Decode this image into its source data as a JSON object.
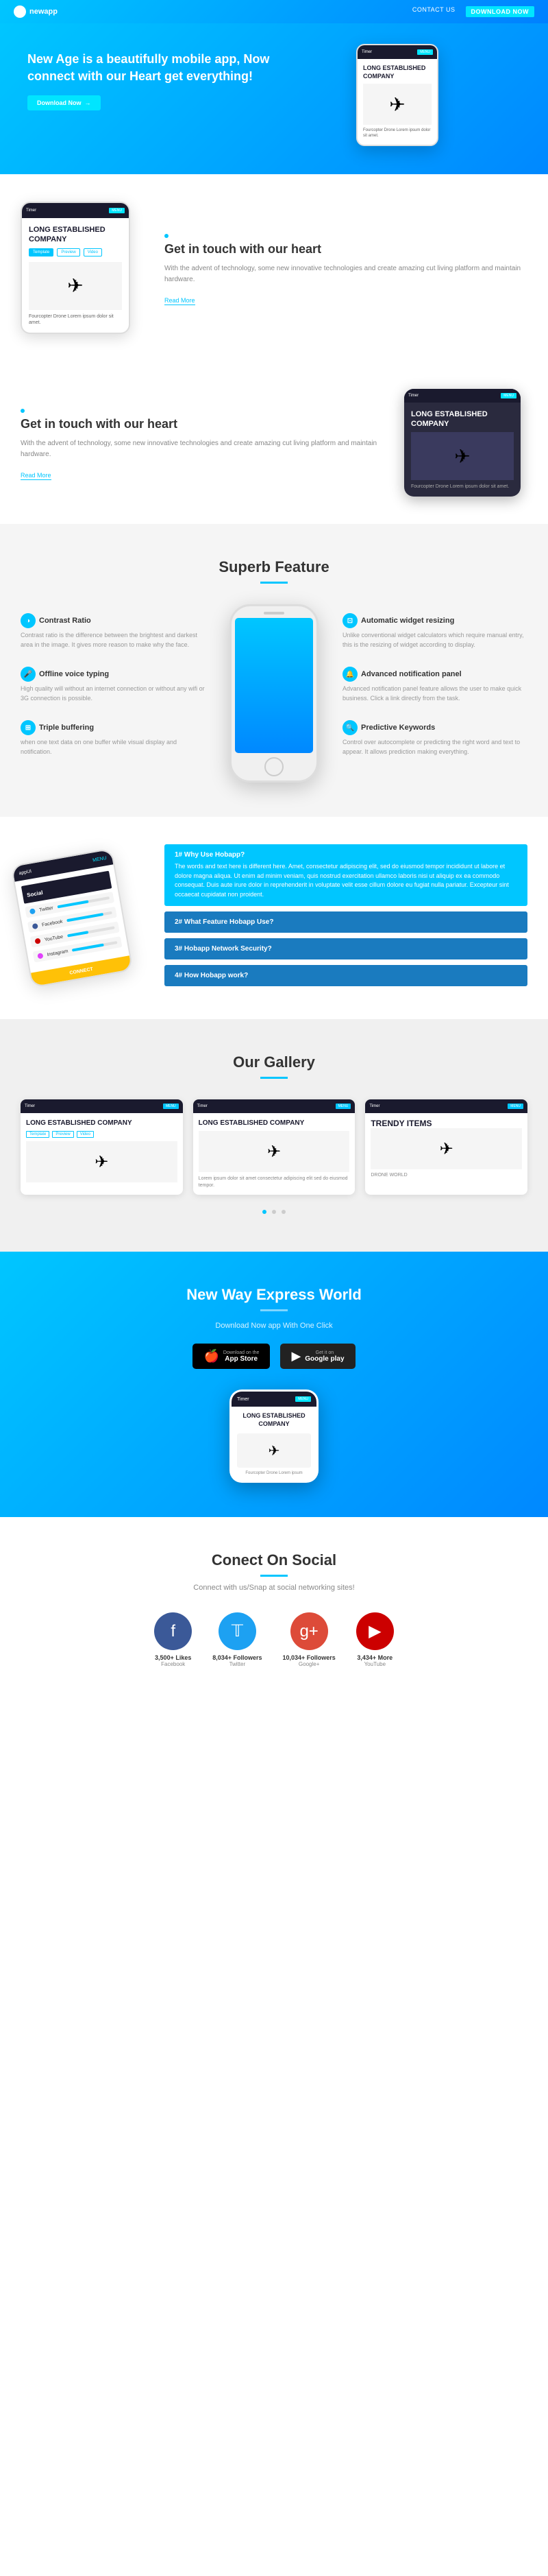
{
  "header": {
    "logo_text": "newapp",
    "nav_contact": "CONTACT US",
    "nav_download": "DOWNLOAD NOW"
  },
  "hero": {
    "title": "New Age is a beautifully mobile app, Now connect with our Heart get everything!",
    "btn_label": "Download Now",
    "phone": {
      "logo": "Timer",
      "btn": "MENU",
      "title": "LONG ESTABLISHED COMPANY",
      "caption": "Fourcopter Drone Lorem ipsum dolor sit amet."
    }
  },
  "section2": {
    "dot_label": "",
    "title": "Get in touch with our heart",
    "text": "With the advent of technology, some new innovative technologies and create amazing cut living platform and maintain hardware.",
    "link": "Read More",
    "phone": {
      "logo": "Timer",
      "btn": "MENU",
      "title": "LONG ESTABLISHED COMPANY",
      "tab1": "Template",
      "tab2": "Preview",
      "tab3": "Video",
      "caption": "Fourcopter Drone Lorem ipsum dolor sit amet."
    }
  },
  "section3": {
    "title": "Get in touch with our heart",
    "text": "With the advent of technology, some new innovative technologies and create amazing cut living platform and maintain hardware.",
    "link": "Read More",
    "phone": {
      "logo": "Timer",
      "btn": "MENU",
      "title": "LONG ESTABLISHED COMPANY",
      "caption": "Fourcopter Drone Lorem ipsum dolor sit amet."
    }
  },
  "superb": {
    "title": "Superb Feature",
    "features_left": [
      {
        "title": "Contrast Ratio",
        "text": "Contrast ratio is the difference between the brightest and darkest area in the image. It gives more reason to make why the face."
      },
      {
        "title": "Offline voice typing",
        "text": "High quality will without an internet connection or without any wifi or 3G connection is possible."
      },
      {
        "title": "Triple buffering",
        "text": "when one text data on one buffer while visual display and notification."
      }
    ],
    "features_right": [
      {
        "title": "Automatic widget resizing",
        "text": "Unlike conventional widget calculators which require manual entry, this is the resizing of widget according to display."
      },
      {
        "title": "Advanced notification panel",
        "text": "Advanced notification panel feature allows the user to make quick business. Click a link directly from the task."
      },
      {
        "title": "Predictive Keywords",
        "text": "Control over autocomplete or predicting the right word and text to appear. It allows prediction making everything."
      }
    ]
  },
  "why": {
    "cards": [
      {
        "title": "1# Why Use Hobapp?",
        "body": "The words and text here is different here. Amet, consectetur adipiscing elit, sed do eiusmod tempor incididunt ut labore et dolore magna aliqua. Ut enim ad minim veniam, quis nostrud exercitation ullamco laboris nisi ut aliquip ex ea commodo consequat. Duis aute irure dolor in reprehenderit in voluptate velit esse cillum dolore eu fugiat nulla pariatur. Excepteur sint occaecat cupidatat non proident."
      },
      {
        "title": "2# What Feature Hobapp Use?",
        "body": ""
      },
      {
        "title": "3# Hobapp Network Security?",
        "body": ""
      },
      {
        "title": "4# How Hobapp work?",
        "body": ""
      }
    ],
    "social_labels": [
      "Social",
      "Twitter",
      "Facebook",
      "YouTube",
      "Instagram"
    ],
    "social_values": [
      80,
      60,
      90,
      45,
      70
    ]
  },
  "gallery": {
    "title": "Our Gallery",
    "items": [
      {
        "logo": "Timer",
        "btn": "MENU",
        "title": "LONG ESTABLISHED COMPANY",
        "tab1": "Template",
        "tab2": "Preview",
        "tab3": "Video"
      },
      {
        "logo": "Timer",
        "btn": "MENU",
        "title": "LONG ESTABLISHED COMPANY",
        "text": "Lorem ipsum dolor sit amet consectetur adipiscing elit sed do eiusmod tempor."
      },
      {
        "logo": "Timer",
        "btn": "MENU",
        "title": "TRENDY ITEMS",
        "sub": "DRONE WORLD"
      }
    ]
  },
  "express": {
    "title": "New Way Express World",
    "sub": "Download Now app With One Click",
    "appstore_label": "Download on the",
    "appstore_name": "App Store",
    "playstore_label": "Get it on",
    "playstore_name": "Google play",
    "phone": {
      "logo": "Timer",
      "btn": "MENU",
      "title": "LONG ESTABLISHED COMPANY"
    }
  },
  "social_connect": {
    "title": "Conect On Social",
    "sub": "Connect with us/Snap at social networking sites!",
    "items": [
      {
        "name": "Facebook",
        "icon": "f",
        "count": "3,500+ Likes",
        "color": "fb"
      },
      {
        "name": "Twitter",
        "icon": "t",
        "count": "8,034+ Followers",
        "color": "tw"
      },
      {
        "name": "Google+",
        "icon": "g+",
        "count": "10,034+ Followers",
        "color": "gp"
      },
      {
        "name": "YouTube",
        "icon": "▶",
        "count": "3,434+ More",
        "color": "yt"
      }
    ]
  }
}
